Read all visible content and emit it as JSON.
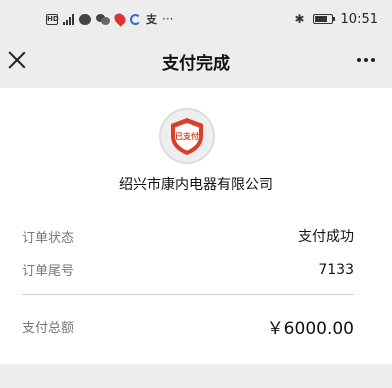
{
  "status_bar": {
    "hd": "HD",
    "network": "4G",
    "zhi": "支",
    "more": "···",
    "bluetooth": "✱",
    "time": "10:51"
  },
  "nav": {
    "title": "支付完成"
  },
  "payment": {
    "logo_text": "已支付",
    "merchant": "绍兴市康内电器有限公司",
    "rows": [
      {
        "label": "订单状态",
        "value": "支付成功"
      },
      {
        "label": "订单尾号",
        "value": "7133"
      },
      {
        "label": "支付总额",
        "value": "￥6000.00"
      }
    ]
  },
  "colors": {
    "accent": "#d9402b",
    "background": "#ededed"
  }
}
